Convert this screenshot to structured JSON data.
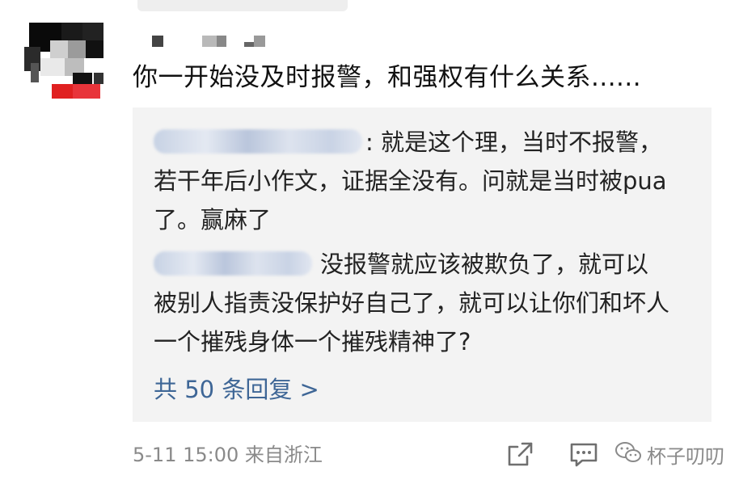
{
  "post": {
    "comment_text": "你一开始没及时报警，和强权有什么关系......",
    "replies": [
      {
        "text": ": 就是这个理，当时不报警，若干年后小作文，证据全没有。问就是当时被pua了。赢麻了"
      },
      {
        "text": "没报警就应该被欺负了，就可以被别人指责没保护好自己了，就可以让你们和坏人一个摧残身体一个摧残精神了?"
      }
    ],
    "more_replies_label": "共 50 条回复 >",
    "meta_text": "5-11 15:00  来自浙江",
    "watermark_text": "杯子叨叨"
  },
  "colors": {
    "link": "#3e6696",
    "reply_bg": "#f3f3f3",
    "meta_gray": "#8a8a8a",
    "avatar_red": "#e02020"
  },
  "icons": {
    "share": "share-icon",
    "comment": "comment-icon",
    "watermark_logo": "wechat-logo-icon"
  }
}
